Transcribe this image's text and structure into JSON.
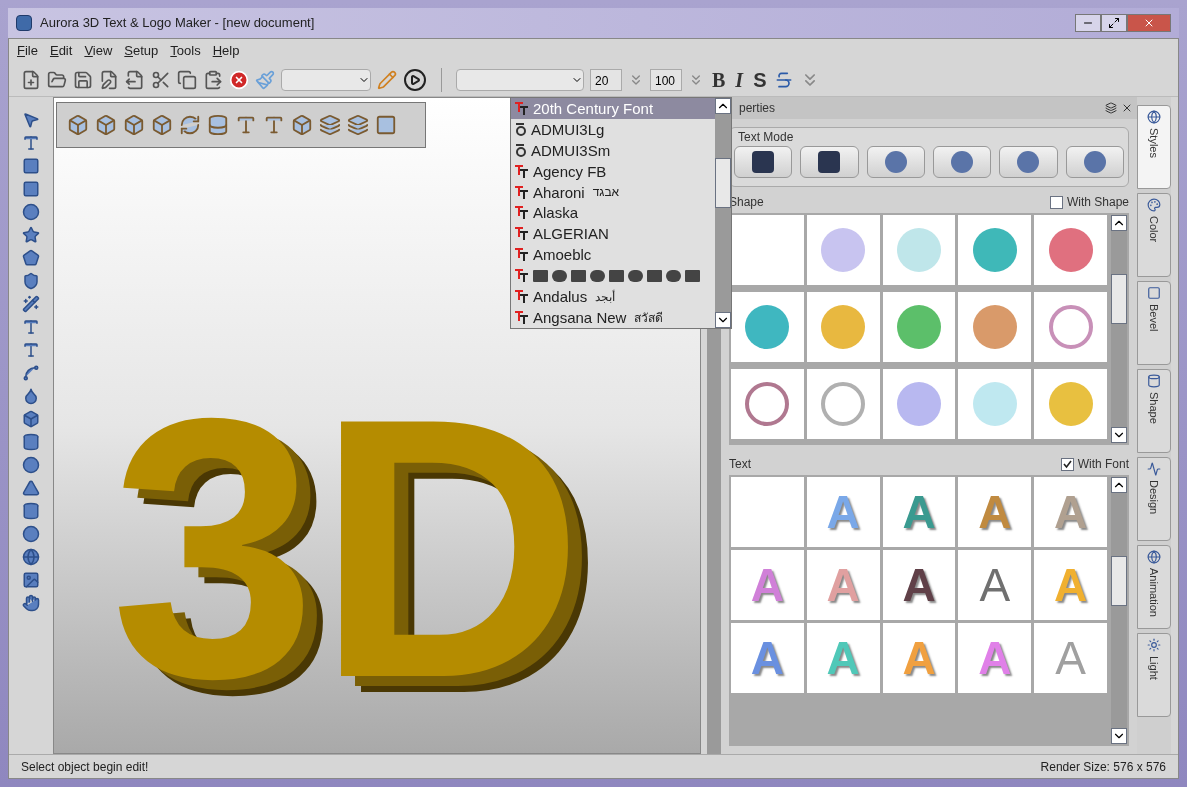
{
  "window": {
    "title": "Aurora 3D Text & Logo Maker - [new document]"
  },
  "menu": [
    {
      "label": "File"
    },
    {
      "label": "Edit"
    },
    {
      "label": "View"
    },
    {
      "label": "Setup"
    },
    {
      "label": "Tools"
    },
    {
      "label": "Help"
    }
  ],
  "toolbar": {
    "font_size": "20",
    "scale": "100",
    "format_buttons": [
      "B",
      "I",
      "S"
    ]
  },
  "canvas": {
    "text": "3D"
  },
  "font_list": [
    {
      "name": "20th Century Font",
      "kind": "truetype",
      "selected": true
    },
    {
      "name": "ADMUI3Lg",
      "kind": "opentype",
      "selected": false
    },
    {
      "name": "ADMUI3Sm",
      "kind": "opentype",
      "selected": false
    },
    {
      "name": "Agency FB",
      "kind": "truetype",
      "selected": false
    },
    {
      "name": "Aharoni",
      "sample": "אבגד",
      "kind": "truetype",
      "selected": false
    },
    {
      "name": "Alaska",
      "kind": "truetype",
      "selected": false
    },
    {
      "name": "ALGERIAN",
      "kind": "truetype",
      "selected": false
    },
    {
      "name": "Amoeblc",
      "kind": "truetype",
      "selected": false
    },
    {
      "kind": "symbol",
      "selected": false
    },
    {
      "name": "Andalus",
      "sample": "أبجد",
      "kind": "truetype",
      "selected": false
    },
    {
      "name": "Angsana New",
      "sample": "สวัสดี",
      "kind": "truetype",
      "selected": false
    }
  ],
  "properties": {
    "title": "perties",
    "text_mode": {
      "label": "Text Mode"
    },
    "shape": {
      "label": "Shape",
      "with_shape": {
        "label": "With Shape",
        "checked": false
      },
      "items": [
        {
          "kind": "empty"
        },
        {
          "kind": "sphere",
          "color": "#c8c4f0"
        },
        {
          "kind": "sphere",
          "color": "#bfe6ea"
        },
        {
          "kind": "sphere",
          "color": "#3fb8b8"
        },
        {
          "kind": "sphere",
          "color": "#e0707f"
        },
        {
          "kind": "sphere",
          "color": "#3fb7c0"
        },
        {
          "kind": "sphere",
          "color": "#e8b840"
        },
        {
          "kind": "sphere",
          "color": "#5cbf6a"
        },
        {
          "kind": "sphere",
          "color": "#d99a6a"
        },
        {
          "kind": "ring",
          "color": "#c890b8"
        },
        {
          "kind": "ring",
          "color": "#b07890"
        },
        {
          "kind": "ring",
          "color": "#b0b0b0"
        },
        {
          "kind": "sphere",
          "color": "#b8b8f0"
        },
        {
          "kind": "sphere",
          "color": "#bfe8f0"
        },
        {
          "kind": "sphere",
          "color": "#e8c040"
        }
      ]
    },
    "text": {
      "label": "Text",
      "with_font": {
        "label": "With Font",
        "checked": true
      },
      "items": [
        {
          "kind": "empty"
        },
        {
          "kind": "solid",
          "letter": "A",
          "color": "#7aa8e8"
        },
        {
          "kind": "solid",
          "letter": "A",
          "color": "#3a9a90"
        },
        {
          "kind": "solid",
          "letter": "A",
          "color": "#c08a40"
        },
        {
          "kind": "solid",
          "letter": "A",
          "color": "#b0a090"
        },
        {
          "kind": "solid",
          "letter": "A",
          "color": "#d080d8"
        },
        {
          "kind": "solid",
          "letter": "A",
          "color": "#e0a0a0"
        },
        {
          "kind": "solid",
          "letter": "A",
          "color": "#604048"
        },
        {
          "kind": "outline",
          "letter": "A",
          "color": "#707070"
        },
        {
          "kind": "solid",
          "letter": "A",
          "color": "#f0b030"
        },
        {
          "kind": "solid",
          "letter": "A",
          "color": "#6a90e0"
        },
        {
          "kind": "solid",
          "letter": "A",
          "color": "#50c8b8"
        },
        {
          "kind": "solid",
          "letter": "A",
          "color": "#f0a040"
        },
        {
          "kind": "solid",
          "letter": "A",
          "color": "#e080e8"
        },
        {
          "kind": "outline",
          "letter": "A",
          "color": "#a0a0a0"
        }
      ]
    }
  },
  "side_tabs": [
    {
      "label": "Styles",
      "selected": true
    },
    {
      "label": "Color",
      "selected": false
    },
    {
      "label": "Bevel",
      "selected": false
    },
    {
      "label": "Shape",
      "selected": false
    },
    {
      "label": "Design",
      "selected": false
    },
    {
      "label": "Animation",
      "selected": false
    },
    {
      "label": "Light",
      "selected": false
    }
  ],
  "status_bar": {
    "message": "Select object begin edit!",
    "render_size": "Render Size: 576 x 576"
  }
}
